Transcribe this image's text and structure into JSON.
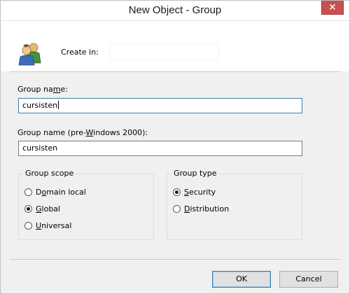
{
  "window": {
    "title": "New Object - Group",
    "close_glyph": "✕"
  },
  "header": {
    "icon": "group-icon",
    "create_in_label": "Create in:",
    "create_in_value": ""
  },
  "group_name": {
    "label_pre": "Group na",
    "label_u": "m",
    "label_post": "e:",
    "value": "cursisten"
  },
  "group_name_pre2000": {
    "label_pre": "Group name (pre-",
    "label_u": "W",
    "label_post": "indows 2000):",
    "value": "cursisten"
  },
  "group_scope": {
    "title": "Group scope",
    "options": [
      {
        "pre": "D",
        "u": "o",
        "post": "main local",
        "checked": false
      },
      {
        "pre": "",
        "u": "G",
        "post": "lobal",
        "checked": true
      },
      {
        "pre": "",
        "u": "U",
        "post": "niversal",
        "checked": false
      }
    ]
  },
  "group_type": {
    "title": "Group type",
    "options": [
      {
        "pre": "",
        "u": "S",
        "post": "ecurity",
        "checked": true
      },
      {
        "pre": "",
        "u": "D",
        "post": "istribution",
        "checked": false
      }
    ]
  },
  "buttons": {
    "ok_label": "OK",
    "cancel_label": "Cancel"
  },
  "colors": {
    "close_button": "#c75050",
    "default_button_border": "#3c7fb1",
    "dialog_background": "#f0f0f0"
  }
}
